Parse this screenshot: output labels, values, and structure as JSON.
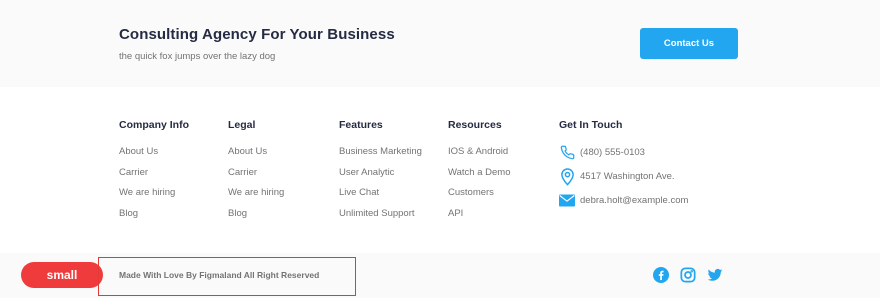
{
  "header": {
    "title": "Consulting Agency For Your Business",
    "subtitle": "the quick fox jumps over the lazy dog",
    "cta_label": "Contact Us"
  },
  "columns": [
    {
      "title": "Company Info",
      "links": [
        "About Us",
        "Carrier",
        "We are hiring",
        "Blog"
      ]
    },
    {
      "title": "Legal",
      "links": [
        "About Us",
        "Carrier",
        "We are hiring",
        "Blog"
      ]
    },
    {
      "title": "Features",
      "links": [
        "Business Marketing",
        "User Analytic",
        "Live Chat",
        "Unlimited Support"
      ]
    },
    {
      "title": "Resources",
      "links": [
        "IOS & Android",
        "Watch a Demo",
        "Customers",
        "API"
      ]
    }
  ],
  "contact": {
    "title": "Get In Touch",
    "phone": "(480) 555-0103",
    "address": "4517 Washington Ave.",
    "email": "debra.holt@example.com",
    "icons": [
      "phone-icon",
      "location-pin-icon",
      "mail-icon"
    ]
  },
  "footer": {
    "tag": "small",
    "copyright": "Made With Love By Figmaland All Right Reserved",
    "social": [
      "facebook-icon",
      "instagram-icon",
      "twitter-icon"
    ]
  },
  "colors": {
    "accent": "#23a6f0",
    "heading": "#252b42",
    "muted": "#737373",
    "annotation_red": "#ef3b3b"
  }
}
